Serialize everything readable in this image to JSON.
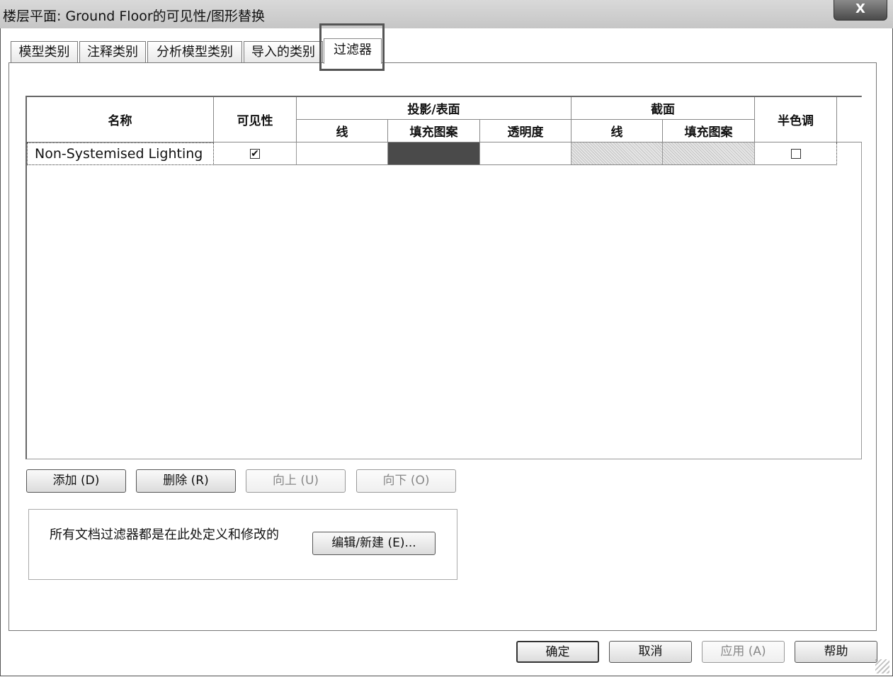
{
  "window": {
    "title": "楼层平面: Ground Floor的可见性/图形替换",
    "close_label": "X"
  },
  "tabs": [
    {
      "label": "模型类别"
    },
    {
      "label": "注释类别"
    },
    {
      "label": "分析模型类别"
    },
    {
      "label": "导入的类别"
    },
    {
      "label": "过滤器",
      "active": true
    }
  ],
  "table": {
    "headers": {
      "name": "名称",
      "visibility": "可见性",
      "projection_surface": "投影/表面",
      "line": "线",
      "fill_pattern": "填充图案",
      "transparency": "透明度",
      "cut": "截面",
      "cut_line": "线",
      "cut_fill_pattern": "填充图案",
      "halftone": "半色调"
    },
    "rows": [
      {
        "name": "Non-Systemised Lighting",
        "visible": true,
        "halftone": false
      }
    ]
  },
  "buttons": {
    "add": "添加 (D)",
    "delete": "删除 (R)",
    "up": "向上 (U)",
    "down": "向下 (O)",
    "edit_new": "编辑/新建 (E)...",
    "ok": "确定",
    "cancel": "取消",
    "apply": "应用 (A)",
    "help": "帮助"
  },
  "info": {
    "text": "所有文档过滤器都是在此处定义和修改的"
  },
  "colors": {
    "fill_override": "#4a4a4a",
    "cut_pattern": "#bdbdbd"
  }
}
